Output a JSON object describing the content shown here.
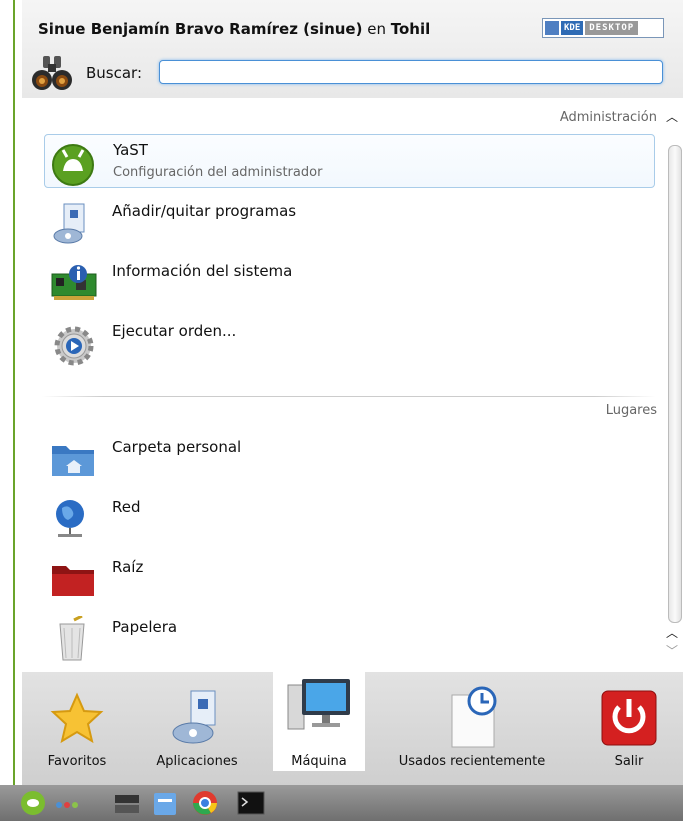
{
  "header": {
    "user_name": "Sinue Benjamín Bravo Ramírez (sinue)",
    "connector": " en ",
    "host": "Tohil",
    "kde_badge_left": "KDE",
    "kde_badge_right": "DESKTOP",
    "search_label": "Buscar:",
    "search_value": ""
  },
  "sections": {
    "admin_label": "Administración",
    "places_label": "Lugares"
  },
  "admin_items": [
    {
      "title": "YaST",
      "subtitle": "Configuración del administrador"
    },
    {
      "title": "Añadir/quitar programas",
      "subtitle": ""
    },
    {
      "title": "Información del sistema",
      "subtitle": ""
    },
    {
      "title": "Ejecutar orden...",
      "subtitle": ""
    }
  ],
  "place_items": [
    {
      "title": "Carpeta personal"
    },
    {
      "title": "Red"
    },
    {
      "title": "Raíz"
    },
    {
      "title": "Papelera"
    }
  ],
  "tabs": [
    {
      "label": "Favoritos",
      "icon": "star-icon"
    },
    {
      "label": "Aplicaciones",
      "icon": "applications-icon"
    },
    {
      "label": "Máquina",
      "icon": "computer-icon",
      "active": true
    },
    {
      "label": "Usados recientemente",
      "icon": "recent-documents-icon"
    },
    {
      "label": "Salir",
      "icon": "power-icon"
    }
  ],
  "taskbar": {
    "icons": [
      "opensuse-menu-icon",
      "dots-icon",
      "show-desktop-icon",
      "file-manager-icon",
      "chrome-icon",
      "terminal-icon"
    ]
  },
  "colors": {
    "accent": "#4a90d6",
    "selected_border": "#a9cce9",
    "suse_green": "#6aa42a",
    "power_red": "#d42020"
  }
}
